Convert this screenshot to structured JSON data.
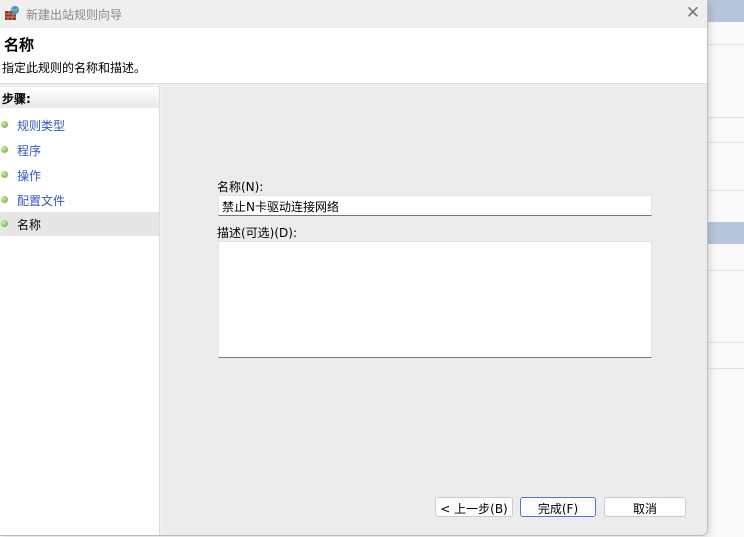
{
  "window": {
    "title": "新建出站规则向导",
    "close": "✕"
  },
  "header": {
    "title": "名称",
    "subtitle": "指定此规则的名称和描述。"
  },
  "steps": {
    "heading": "步骤:",
    "items": [
      {
        "label": "规则类型"
      },
      {
        "label": "程序"
      },
      {
        "label": "操作"
      },
      {
        "label": "配置文件"
      },
      {
        "label": "名称"
      }
    ]
  },
  "form": {
    "name_label": "名称(N):",
    "name_value": "禁止N卡驱动连接网络",
    "desc_label": "描述(可选)(D):",
    "desc_value": ""
  },
  "buttons": {
    "back": "< 上一步(B)",
    "finish": "完成(F)",
    "cancel": "取消"
  }
}
